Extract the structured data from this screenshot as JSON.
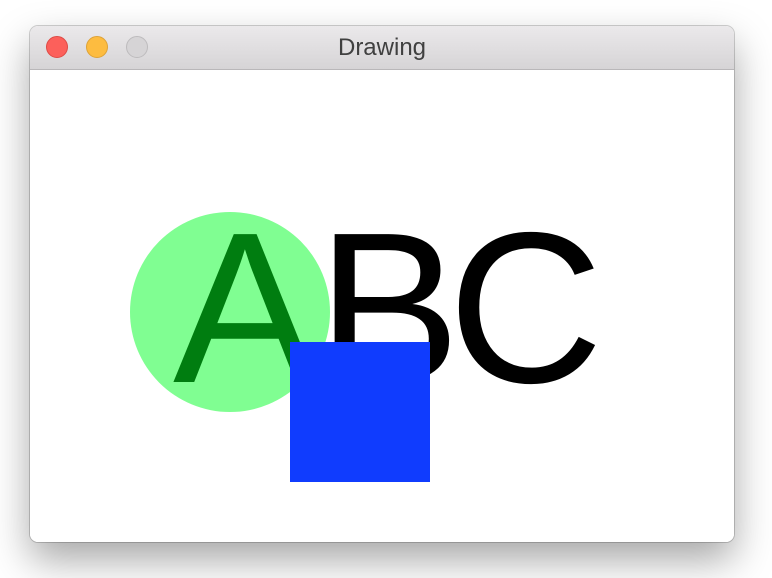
{
  "window": {
    "title": "Drawing"
  },
  "titlebar": {
    "buttons": [
      {
        "name": "close",
        "color": "#fc605b"
      },
      {
        "name": "minimize",
        "color": "#fdbc40"
      },
      {
        "name": "zoom",
        "color": "#d6d4d6"
      }
    ]
  },
  "drawing": {
    "letters": [
      {
        "char": "A",
        "color": "#007d10"
      },
      {
        "char": "B",
        "color": "#000000"
      },
      {
        "char": "C",
        "color": "#000000"
      }
    ],
    "circle_color": "#80fe92",
    "square_color": "#103cfe"
  }
}
